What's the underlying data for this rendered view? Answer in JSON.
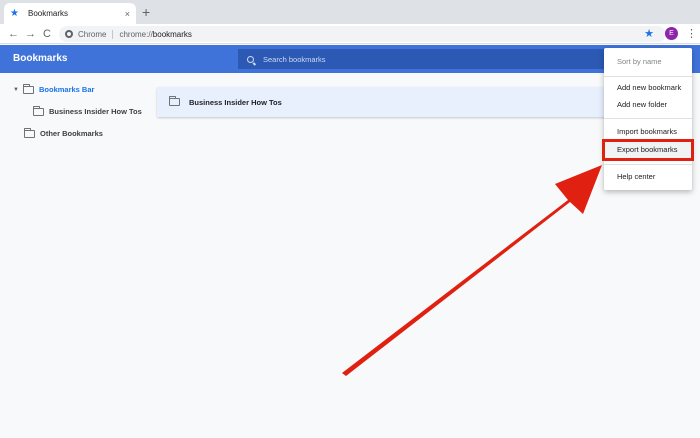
{
  "tab": {
    "title": "Bookmarks",
    "close": "×",
    "new_tab": "+"
  },
  "toolbar": {
    "back": "←",
    "forward": "→",
    "reload": "C",
    "chip": "Chrome",
    "url_scheme": "chrome://",
    "url_host": "bookmarks",
    "bookmark_star": "★",
    "avatar_letter": "E",
    "menu": "⋮"
  },
  "header": {
    "title": "Bookmarks",
    "search_placeholder": "Search bookmarks"
  },
  "sidebar": {
    "items": [
      {
        "label": "Bookmarks Bar"
      },
      {
        "label": "Business Insider How Tos"
      },
      {
        "label": "Other Bookmarks"
      }
    ]
  },
  "list": {
    "items": [
      {
        "label": "Business Insider How Tos"
      }
    ]
  },
  "menu": {
    "sort": "Sort by name",
    "add_bookmark": "Add new bookmark",
    "add_folder": "Add new folder",
    "import": "Import bookmarks",
    "export": "Export bookmarks",
    "help": "Help center"
  },
  "colors": {
    "accent": "#3f73d9",
    "annotation_red": "#e02010",
    "avatar": "#8e24aa"
  }
}
